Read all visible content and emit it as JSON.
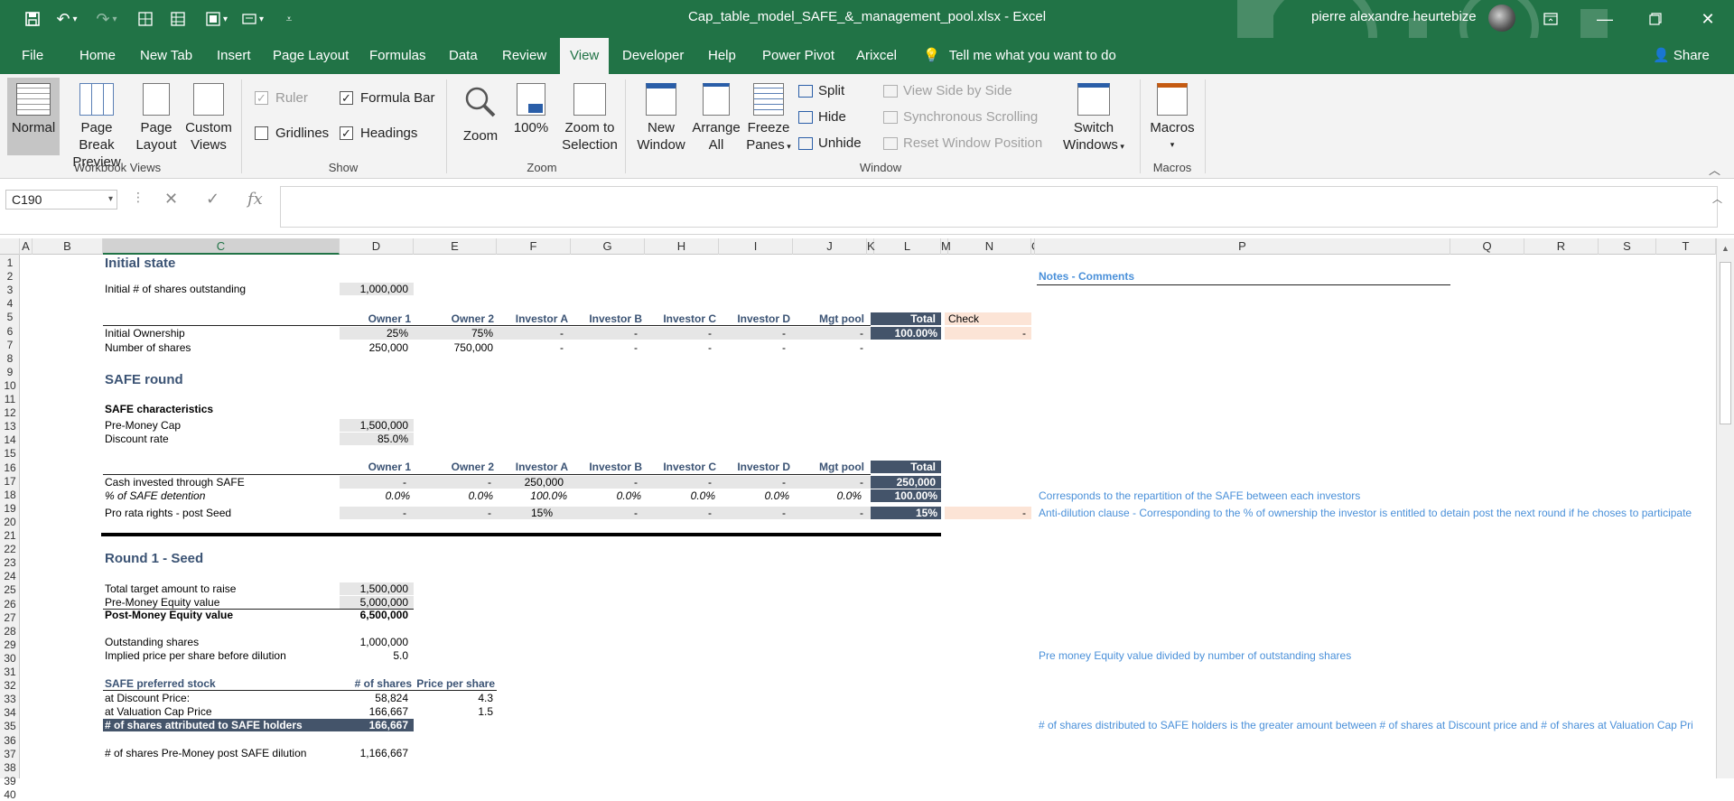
{
  "app": {
    "title": "Cap_table_model_SAFE_&_management_pool.xlsx  -  Excel",
    "user": "pierre alexandre heurtebize",
    "accent": "#217346"
  },
  "tabs": [
    "File",
    "Home",
    "New Tab",
    "Insert",
    "Page Layout",
    "Formulas",
    "Data",
    "Review",
    "View",
    "Developer",
    "Help",
    "Power Pivot",
    "Arixcel"
  ],
  "active_tab": "View",
  "tell_me": "Tell me what you want to do",
  "share": "Share",
  "ribbon": {
    "workbook_views": {
      "label": "Workbook Views",
      "normal": "Normal",
      "page_break_1": "Page Break",
      "page_break_2": "Preview",
      "page_layout_1": "Page",
      "page_layout_2": "Layout",
      "custom_1": "Custom",
      "custom_2": "Views"
    },
    "show": {
      "label": "Show",
      "ruler": "Ruler",
      "ruler_checked": true,
      "formula_bar": "Formula Bar",
      "formula_bar_checked": true,
      "gridlines": "Gridlines",
      "gridlines_checked": false,
      "headings": "Headings",
      "headings_checked": true
    },
    "zoom": {
      "label": "Zoom",
      "zoom": "Zoom",
      "hundred": "100%",
      "sel_1": "Zoom to",
      "sel_2": "Selection"
    },
    "window": {
      "label": "Window",
      "new_1": "New",
      "new_2": "Window",
      "arrange_1": "Arrange",
      "arrange_2": "All",
      "freeze_1": "Freeze",
      "freeze_2": "Panes",
      "split": "Split",
      "hide": "Hide",
      "unhide": "Unhide",
      "side": "View Side by Side",
      "sync": "Synchronous Scrolling",
      "reset": "Reset Window Position",
      "switch_1": "Switch",
      "switch_2": "Windows"
    },
    "macros": {
      "label": "Macros",
      "macros": "Macros"
    }
  },
  "formula_bar": {
    "name_box": "C190",
    "formula": ""
  },
  "columns": [
    "A",
    "B",
    "C",
    "D",
    "E",
    "F",
    "G",
    "H",
    "I",
    "J",
    "K",
    "L",
    "M",
    "N",
    "O",
    "P",
    "Q",
    "R",
    "S",
    "T"
  ],
  "rows": [
    "1",
    "2",
    "3",
    "4",
    "5",
    "6",
    "7",
    "8",
    "9",
    "10",
    "11",
    "12",
    "13",
    "14",
    "15",
    "16",
    "17",
    "18",
    "19",
    "20",
    "21",
    "22",
    "23",
    "24",
    "25",
    "26",
    "27",
    "28",
    "29",
    "30",
    "31",
    "32",
    "33",
    "34",
    "35",
    "36",
    "37",
    "38",
    "39",
    "40"
  ],
  "sheet": {
    "initial": {
      "title": "Initial state",
      "shares_label": "Initial # of shares outstanding",
      "shares_value": "1,000,000",
      "headers": [
        "Owner 1",
        "Owner 2",
        "Investor A",
        "Investor B",
        "Investor C",
        "Investor D",
        "Mgt pool"
      ],
      "total": "Total",
      "check": "Check",
      "ownership_label": "Initial Ownership",
      "ownership": [
        "25%",
        "75%",
        "-",
        "-",
        "-",
        "-",
        "-"
      ],
      "ownership_total": "100.00%",
      "ownership_check": "-",
      "nshares_label": "Number of shares",
      "nshares": [
        "250,000",
        "750,000",
        "-",
        "-",
        "-",
        "-",
        "-"
      ],
      "notes_title": "Notes - Comments"
    },
    "safe": {
      "title": "SAFE round",
      "characteristics": "SAFE characteristics",
      "cap_label": "Pre-Money Cap",
      "cap_value": "1,500,000",
      "discount_label": "Discount rate",
      "discount_value": "85.0%",
      "headers": [
        "Owner 1",
        "Owner 2",
        "Investor A",
        "Investor B",
        "Investor C",
        "Investor D",
        "Mgt pool"
      ],
      "total": "Total",
      "cash_label": "Cash invested through SAFE",
      "cash": [
        "-",
        "-",
        "250,000",
        "-",
        "-",
        "-",
        "-"
      ],
      "cash_total": "250,000",
      "det_label": "% of SAFE detention",
      "det": [
        "0.0%",
        "0.0%",
        "100.0%",
        "0.0%",
        "0.0%",
        "0.0%",
        "0.0%"
      ],
      "det_total": "100.00%",
      "det_note": "Corresponds to the repartition of the SAFE between each investors",
      "prorata_label": "Pro rata rights - post Seed",
      "prorata": [
        "-",
        "-",
        "15%",
        "-",
        "-",
        "-",
        "-"
      ],
      "prorata_total": "15%",
      "prorata_check": "-",
      "prorata_note": "Anti-dilution clause - Corresponding to the % of ownership the investor is entitled to detain post the next round if he choses to participate"
    },
    "seed": {
      "title": "Round 1 - Seed",
      "target_label": "Total target amount to raise",
      "target_value": "1,500,000",
      "pre_label": "Pre-Money Equity value",
      "pre_value": "5,000,000",
      "post_label": "Post-Money Equity value",
      "post_value": "6,500,000",
      "out_label": "Outstanding shares",
      "out_value": "1,000,000",
      "price_label": "Implied price per share before dilution",
      "price_value": "5.0",
      "price_note": "Pre money Equity value divided by number of outstanding shares",
      "pref_label": "SAFE preferred stock",
      "pref_h1": "# of shares",
      "pref_h2": "Price per share",
      "disc_label": "at Discount Price:",
      "disc_shares": "58,824",
      "disc_price": "4.3",
      "cap_label": "at Valuation Cap Price",
      "cap_shares": "166,667",
      "cap_price": "1.5",
      "attr_label": "# of shares attributed to SAFE holders",
      "attr_value": "166,667",
      "attr_note": "# of shares distributed to SAFE holders is the greater amount between # of shares at Discount price and # of shares at Valuation Cap Pri",
      "premoney_label": "# of shares Pre-Money post SAFE dilution",
      "premoney_value": "1,166,667"
    }
  }
}
